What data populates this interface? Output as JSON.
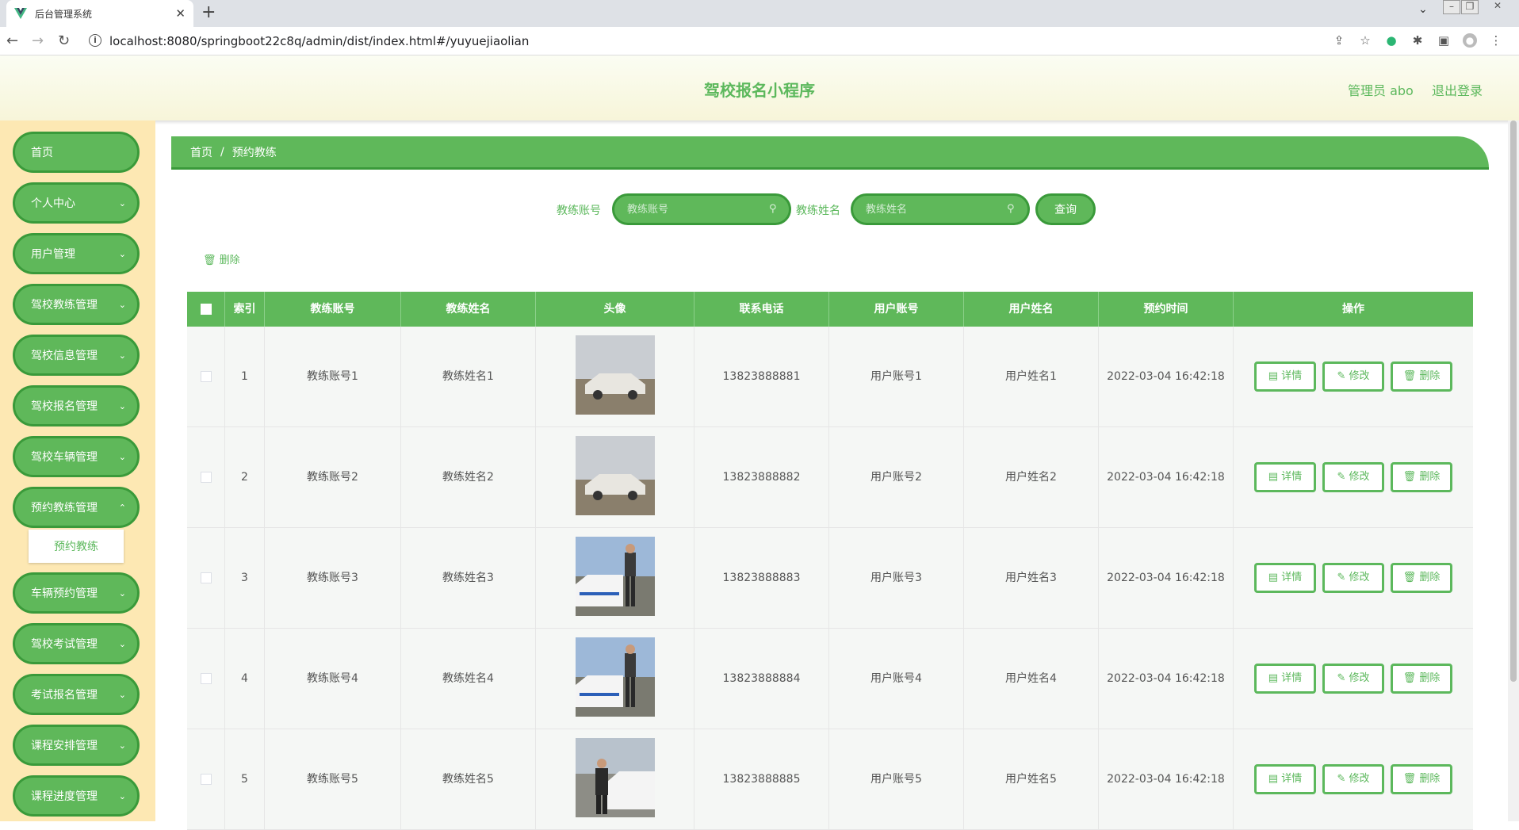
{
  "browser": {
    "tab_title": "后台管理系统",
    "url": "localhost:8080/springboot22c8q/admin/dist/index.html#/yuyuejiaolian"
  },
  "header": {
    "title": "驾校报名小程序",
    "admin_label": "管理员 abo",
    "logout": "退出登录"
  },
  "sidebar": {
    "items": [
      {
        "label": "首页"
      },
      {
        "label": "个人中心"
      },
      {
        "label": "用户管理"
      },
      {
        "label": "驾校教练管理"
      },
      {
        "label": "驾校信息管理"
      },
      {
        "label": "驾校报名管理"
      },
      {
        "label": "驾校车辆管理"
      },
      {
        "label": "预约教练管理"
      },
      {
        "label": "车辆预约管理"
      },
      {
        "label": "驾校考试管理"
      },
      {
        "label": "考试报名管理"
      },
      {
        "label": "课程安排管理"
      },
      {
        "label": "课程进度管理"
      }
    ],
    "submenu": "预约教练"
  },
  "breadcrumb": {
    "home": "首页",
    "sep": "/",
    "current": "预约教练"
  },
  "search": {
    "label1": "教练账号",
    "placeholder1": "教练账号",
    "label2": "教练姓名",
    "placeholder2": "教练姓名",
    "button": "查询"
  },
  "bulk_delete": "删除",
  "table": {
    "headers": {
      "index": "索引",
      "coach_account": "教练账号",
      "coach_name": "教练姓名",
      "avatar": "头像",
      "phone": "联系电话",
      "user_account": "用户账号",
      "user_name": "用户姓名",
      "time": "预约时间",
      "ops": "操作"
    },
    "actions": {
      "detail": "详情",
      "edit": "修改",
      "delete": "删除"
    },
    "rows": [
      {
        "index": "1",
        "coach_account": "教练账号1",
        "coach_name": "教练姓名1",
        "phone": "13823888881",
        "user_account": "用户账号1",
        "user_name": "用户姓名1",
        "time": "2022-03-04 16:42:18"
      },
      {
        "index": "2",
        "coach_account": "教练账号2",
        "coach_name": "教练姓名2",
        "phone": "13823888882",
        "user_account": "用户账号2",
        "user_name": "用户姓名2",
        "time": "2022-03-04 16:42:18"
      },
      {
        "index": "3",
        "coach_account": "教练账号3",
        "coach_name": "教练姓名3",
        "phone": "13823888883",
        "user_account": "用户账号3",
        "user_name": "用户姓名3",
        "time": "2022-03-04 16:42:18"
      },
      {
        "index": "4",
        "coach_account": "教练账号4",
        "coach_name": "教练姓名4",
        "phone": "13823888884",
        "user_account": "用户账号4",
        "user_name": "用户姓名4",
        "time": "2022-03-04 16:42:18"
      },
      {
        "index": "5",
        "coach_account": "教练账号5",
        "coach_name": "教练姓名5",
        "phone": "13823888885",
        "user_account": "用户账号5",
        "user_name": "用户姓名5",
        "time": "2022-03-04 16:42:18"
      }
    ]
  }
}
